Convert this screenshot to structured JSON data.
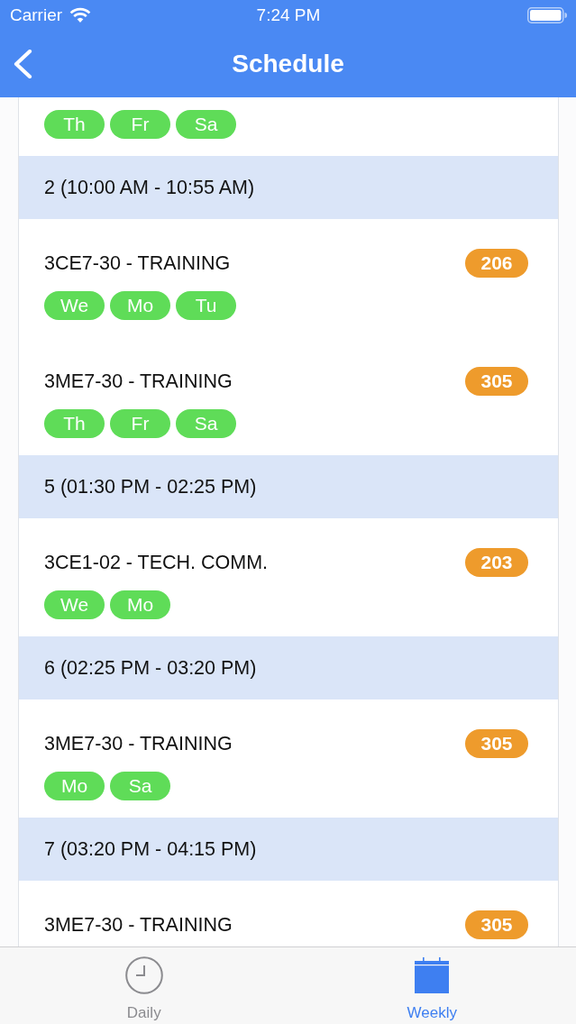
{
  "status_bar": {
    "carrier": "Carrier",
    "time": "7:24 PM"
  },
  "nav_bar": {
    "title": "Schedule"
  },
  "schedule": [
    {
      "classes": [
        {
          "days": [
            "Th",
            "Fr",
            "Sa"
          ]
        }
      ]
    },
    {
      "period": "2 (10:00 AM - 10:55 AM)",
      "classes": [
        {
          "course": "3CE7-30 - TRAINING",
          "room": "206",
          "days": [
            "We",
            "Mo",
            "Tu"
          ]
        },
        {
          "course": "3ME7-30 - TRAINING",
          "room": "305",
          "days": [
            "Th",
            "Fr",
            "Sa"
          ]
        }
      ]
    },
    {
      "period": "5 (01:30 PM - 02:25 PM)",
      "classes": [
        {
          "course": "3CE1-02 - TECH. COMM.",
          "room": "203",
          "days": [
            "We",
            "Mo"
          ]
        }
      ]
    },
    {
      "period": "6 (02:25 PM - 03:20 PM)",
      "classes": [
        {
          "course": "3ME7-30 - TRAINING",
          "room": "305",
          "days": [
            "Mo",
            "Sa"
          ]
        }
      ]
    },
    {
      "period": "7 (03:20 PM - 04:15 PM)",
      "classes": [
        {
          "course": "3ME7-30 - TRAINING",
          "room": "305"
        }
      ]
    }
  ],
  "tabs": [
    {
      "label": "Daily",
      "kind": "clock",
      "selected": false
    },
    {
      "label": "Weekly",
      "kind": "calendar",
      "selected": true
    }
  ]
}
